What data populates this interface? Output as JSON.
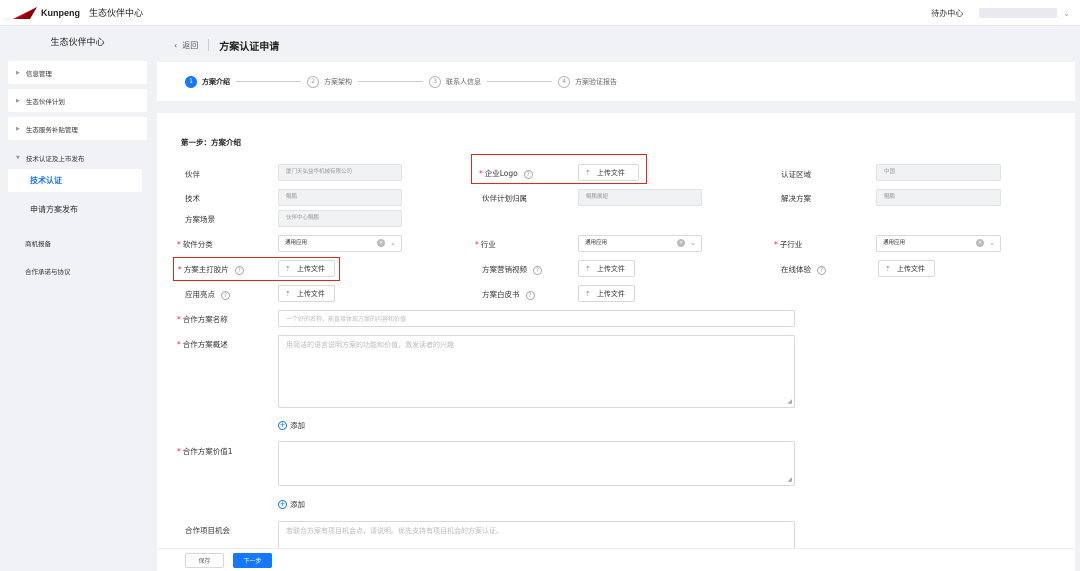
{
  "topbar": {
    "logo_text": "Kunpeng",
    "app_title": "生态伙伴中心",
    "pending": "待办中心"
  },
  "sidebar": {
    "title": "生态伙伴中心",
    "items": [
      {
        "label": "信息管理"
      },
      {
        "label": "生态伙伴计划"
      },
      {
        "label": "生态服务补贴管理"
      },
      {
        "label": "技术认证及上市发布"
      }
    ],
    "subitems": [
      {
        "label": "技术认证",
        "active": true
      },
      {
        "label": "申请方案发布",
        "active": false
      }
    ],
    "plain_items": [
      {
        "label": "商机报备"
      },
      {
        "label": "合作承诺与协议"
      }
    ]
  },
  "header": {
    "back_label": "返回",
    "title": "方案认证申请"
  },
  "steps": [
    {
      "num": "1",
      "label": "方案介绍",
      "active": true
    },
    {
      "num": "2",
      "label": "方案架构",
      "active": false
    },
    {
      "num": "3",
      "label": "联系人信息",
      "active": false
    },
    {
      "num": "4",
      "label": "方案验证报告",
      "active": false
    }
  ],
  "form": {
    "section_title": "第一步：方案介绍",
    "partner": {
      "label": "伙伴",
      "value": "厦门天弘益华机械有限公司"
    },
    "logo": {
      "label": "企业Logo"
    },
    "region": {
      "label": "认证区域",
      "value": "中国"
    },
    "tech": {
      "label": "技术",
      "value": "鲲鹏"
    },
    "plan_owner": {
      "label": "伙伴计划归属",
      "value": "鲲鹏展翅"
    },
    "solution": {
      "label": "解决方案",
      "value": "鲲鹏"
    },
    "scenario": {
      "label": "方案场景",
      "value": "伙伴中心鲲鹏"
    },
    "software_cat": {
      "label": "软件分类",
      "value": "通用应用"
    },
    "industry": {
      "label": "行业",
      "value": "通用应用"
    },
    "sub_industry": {
      "label": "子行业",
      "value": "通用应用"
    },
    "main_slide": {
      "label": "方案主打胶片"
    },
    "marketing_video": {
      "label": "方案营销视频"
    },
    "online_trial": {
      "label": "在线体验"
    },
    "highlights": {
      "label": "应用亮点"
    },
    "whitepaper": {
      "label": "方案白皮书"
    },
    "name": {
      "label": "合作方案名称",
      "placeholder": "一个好的名称，能直接体现方案的内容和价值"
    },
    "overview": {
      "label": "合作方案概述",
      "placeholder": "用简洁的语言说明方案的功能和价值，激发读者的兴趣"
    },
    "value1": {
      "label": "合作方案价值1",
      "placeholder": ""
    },
    "opportunity": {
      "label": "合作项目机会",
      "placeholder": "若联合方案有项目机会点，请说明。优先支持有项目机会的方案认证。"
    },
    "upload_label": "上传文件",
    "add_label": "添加"
  },
  "footer": {
    "save_label": "保存",
    "next_label": "下一步"
  },
  "colors": {
    "accent": "#1677ff",
    "highlight_box": "#e0281e",
    "required": "#f5222d"
  }
}
